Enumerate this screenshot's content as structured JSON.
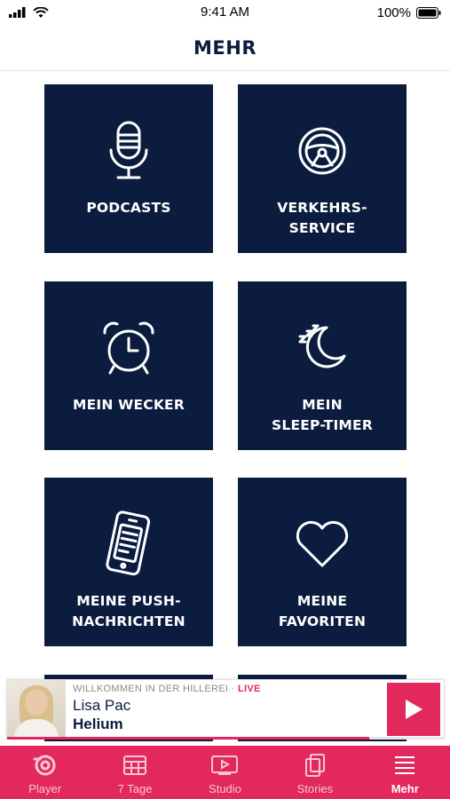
{
  "status_bar": {
    "time": "9:41 AM",
    "battery": "100%"
  },
  "header": {
    "title": "MEHR"
  },
  "tiles": [
    {
      "label": "PODCASTS",
      "icon": "microphone-icon"
    },
    {
      "label": "VERKEHRS-\nSERVICE",
      "icon": "steering-wheel-icon"
    },
    {
      "label": "MEIN WECKER",
      "icon": "alarm-clock-icon"
    },
    {
      "label": "MEIN\nSLEEP-TIMER",
      "icon": "moon-sleep-icon"
    },
    {
      "label": "MEINE PUSH-\nNACHRICHTEN",
      "icon": "phone-message-icon"
    },
    {
      "label": "MEINE\nFAVORITEN",
      "icon": "heart-icon"
    }
  ],
  "mini_player": {
    "show": "WILLKOMMEN IN DER HILLEREI",
    "separator": " · ",
    "live": "LIVE",
    "artist": "Lisa Pac",
    "title": "Helium",
    "progress": 0.83
  },
  "tab_bar": {
    "items": [
      {
        "label": "Player",
        "icon": "radio-logo-icon",
        "active": false
      },
      {
        "label": "7 Tage",
        "icon": "calendar-grid-icon",
        "active": false
      },
      {
        "label": "Studio",
        "icon": "video-play-icon",
        "active": false
      },
      {
        "label": "Stories",
        "icon": "stack-icon",
        "active": false
      },
      {
        "label": "Mehr",
        "icon": "menu-lines-icon",
        "active": true
      }
    ]
  },
  "colors": {
    "navy": "#0b1c3f",
    "accent": "#e2285d"
  }
}
